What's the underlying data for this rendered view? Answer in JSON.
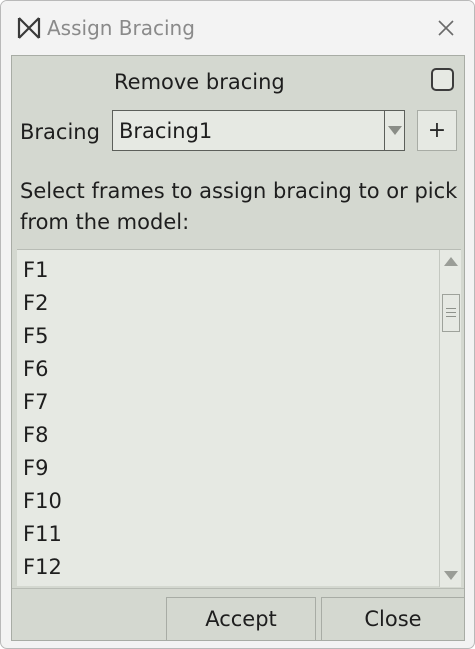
{
  "window": {
    "title": "Assign Bracing"
  },
  "form": {
    "remove_bracing_label": "Remove bracing",
    "remove_bracing_checked": false,
    "bracing_label": "Bracing",
    "bracing_value": "Bracing1",
    "add_label": "+",
    "instructions": "Select frames to assign bracing to or pick from the model:"
  },
  "frames": [
    "F1",
    "F2",
    "F5",
    "F6",
    "F7",
    "F8",
    "F9",
    "F10",
    "F11",
    "F12"
  ],
  "buttons": {
    "accept": "Accept",
    "close": "Close"
  },
  "icons": {
    "app": "bowtie-icon",
    "close": "close-icon",
    "dropdown": "chevron-down-icon"
  }
}
